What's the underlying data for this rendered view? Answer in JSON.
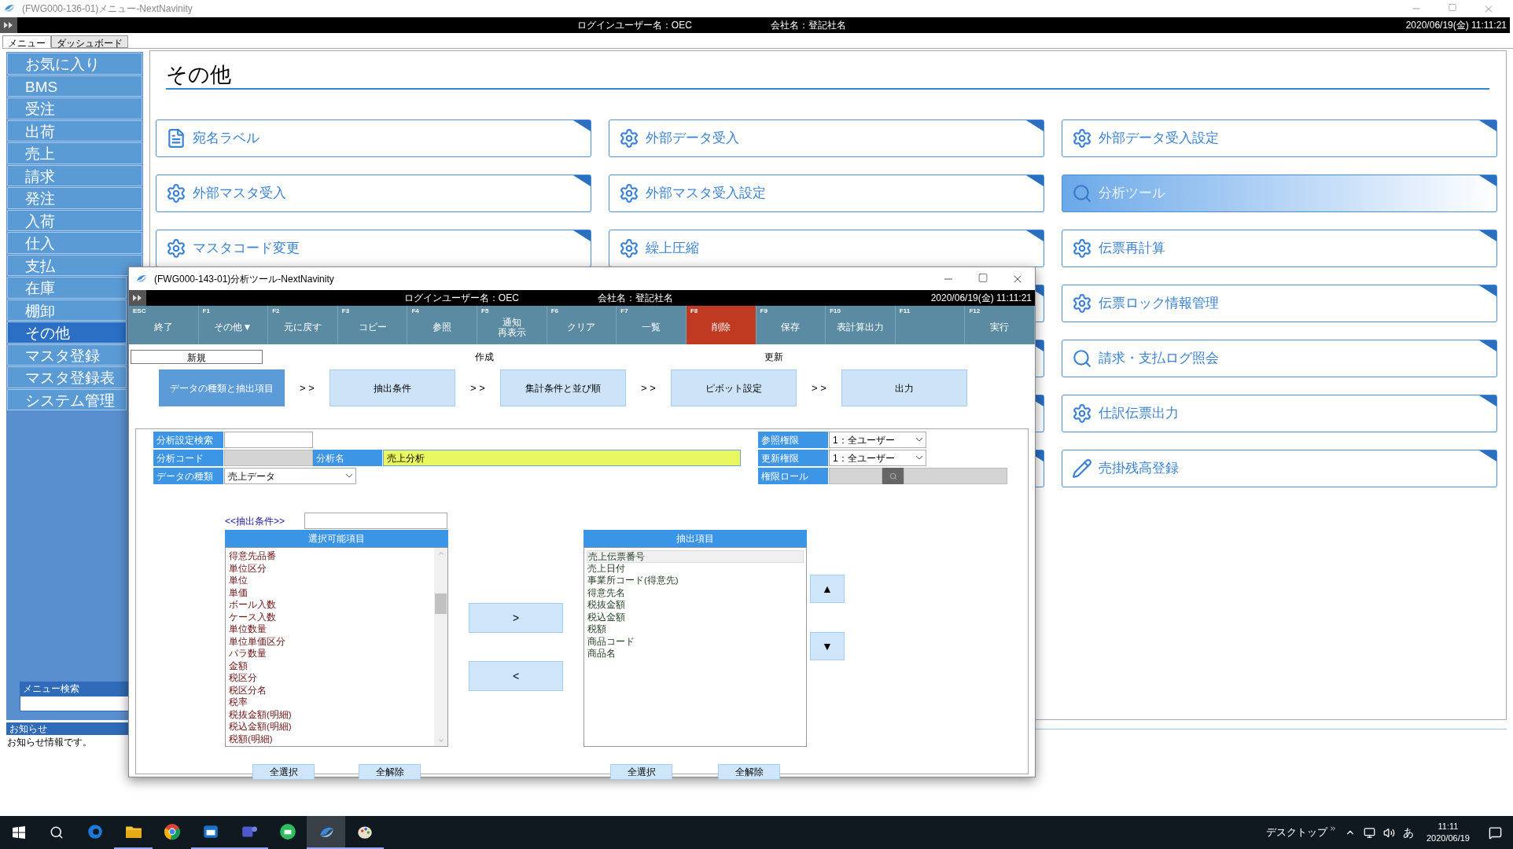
{
  "window": {
    "title": "(FWG000-136-01)メニュー-NextNavinity"
  },
  "header": {
    "login_user": "ログインユーザー名：OEC",
    "company": "会社名：登記社名",
    "datetime": "2020/06/19(金) 11:11:21"
  },
  "tabs": [
    {
      "label": "メニュー",
      "selected": true
    },
    {
      "label": "ダッシュボード",
      "selected": false
    }
  ],
  "sidebar": {
    "items": [
      {
        "label": "お気に入り",
        "selected": false
      },
      {
        "label": "BMS",
        "selected": false
      },
      {
        "label": "受注",
        "selected": false
      },
      {
        "label": "出荷",
        "selected": false
      },
      {
        "label": "売上",
        "selected": false
      },
      {
        "label": "請求",
        "selected": false
      },
      {
        "label": "発注",
        "selected": false
      },
      {
        "label": "入荷",
        "selected": false
      },
      {
        "label": "仕入",
        "selected": false
      },
      {
        "label": "支払",
        "selected": false
      },
      {
        "label": "在庫",
        "selected": false
      },
      {
        "label": "棚卸",
        "selected": false
      },
      {
        "label": "その他",
        "selected": true
      },
      {
        "label": "マスタ登録",
        "selected": false
      },
      {
        "label": "マスタ登録表",
        "selected": false
      },
      {
        "label": "システム管理",
        "selected": false
      }
    ],
    "search": {
      "label": "メニュー検索"
    }
  },
  "notice": {
    "title": "お知らせ",
    "text": "お知らせ情報です。"
  },
  "page": {
    "title": "その他",
    "columns": [
      [
        {
          "label": "宛名ラベル",
          "kind": "document",
          "selected": false
        },
        {
          "label": "外部マスタ受入",
          "kind": "setting",
          "selected": false
        },
        {
          "label": "マスタコード変更",
          "kind": "setting",
          "selected": false
        }
      ],
      [
        {
          "label": "外部データ受入",
          "kind": "setting",
          "selected": false
        },
        {
          "label": "外部マスタ受入設定",
          "kind": "setting",
          "selected": false
        },
        {
          "label": "繰上圧縮",
          "kind": "setting",
          "selected": false
        }
      ],
      [
        {
          "label": "外部データ受入設定",
          "kind": "setting",
          "selected": false
        },
        {
          "label": "分析ツール",
          "kind": "search",
          "selected": true
        },
        {
          "label": "伝票再計算",
          "kind": "setting",
          "selected": false
        },
        {
          "label": "伝票ロック情報管理",
          "kind": "setting",
          "selected": false
        },
        {
          "label": "請求・支払ログ照会",
          "kind": "search",
          "selected": false
        },
        {
          "label": "仕訳伝票出力",
          "kind": "setting",
          "selected": false
        },
        {
          "label": "売掛残高登録",
          "kind": "edit",
          "selected": false
        }
      ]
    ]
  },
  "dialog": {
    "title": "(FWG000-143-01)分析ツール-NextNavinity",
    "header": {
      "login_user": "ログインユーザー名：OEC",
      "company": "会社名：登記社名",
      "datetime": "2020/06/19(金) 11:11:21"
    },
    "function_keys": [
      {
        "key": "ESC",
        "label": "終了",
        "selected": false
      },
      {
        "key": "F1",
        "label": "その他▼",
        "selected": false
      },
      {
        "key": "F2",
        "label": "元に戻す",
        "selected": false
      },
      {
        "key": "F3",
        "label": "コピー",
        "selected": false
      },
      {
        "key": "F4",
        "label": "参照",
        "selected": false
      },
      {
        "key": "F5",
        "label": "通知",
        "label_line2": "再表示",
        "selected": false
      },
      {
        "key": "F6",
        "label": "クリア",
        "selected": false
      },
      {
        "key": "F7",
        "label": "一覧",
        "selected": false
      },
      {
        "key": "F8",
        "label": "削除",
        "selected": true
      },
      {
        "key": "F9",
        "label": "保存",
        "selected": false
      },
      {
        "key": "F10",
        "label": "表計算出力",
        "selected": false
      },
      {
        "key": "F11",
        "selected": false
      },
      {
        "key": "F12",
        "label": "実行",
        "selected": false
      }
    ],
    "modes": [
      {
        "label": "新規",
        "selected": true
      },
      {
        "label": "作成",
        "selected": false
      },
      {
        "label": "更新",
        "selected": false
      }
    ],
    "steps": [
      {
        "label": "データの種類と抽出項目",
        "selected": true
      },
      {
        "separator": "> >",
        "label": "抽出条件",
        "selected": false
      },
      {
        "separator": "> >",
        "label": "集計条件と並び順",
        "selected": false
      },
      {
        "separator": "> >",
        "label": "ピボット設定",
        "selected": false
      },
      {
        "separator": "> >",
        "label": "出力",
        "selected": false
      }
    ],
    "form": {
      "search_label": "分析設定検索",
      "code_label": "分析コード",
      "name_label": "分析名",
      "name_value": "売上分析",
      "type_label": "データの種類",
      "type_value": "売上データ",
      "view_label": "参照権限",
      "view_value": "1：全ユーザー",
      "update_label": "更新権限",
      "update_value": "1：全ユーザー",
      "role_label": "権限ロール"
    },
    "filter_label": "<<抽出条件>>",
    "available": {
      "title": "選択可能項目",
      "items": [
        "得意先品番",
        "単位区分",
        "単位",
        "単価",
        "ボール入数",
        "ケース入数",
        "単位数量",
        "単位単価区分",
        "バラ数量",
        "金額",
        "税区分",
        "税区分名",
        "税率",
        "税抜金額(明細)",
        "税込金額(明細)",
        "税額(明細)"
      ]
    },
    "chosen": {
      "title": "抽出項目",
      "items": [
        {
          "label": "売上伝票番号",
          "selected": true
        },
        {
          "label": "売上日付",
          "selected": false
        },
        {
          "label": "事業所コード(得意先)",
          "selected": false
        },
        {
          "label": "得意先名",
          "selected": false
        },
        {
          "label": "税抜金額",
          "selected": false
        },
        {
          "label": "税込金額",
          "selected": false
        },
        {
          "label": "税額",
          "selected": false
        },
        {
          "label": "商品コード",
          "selected": false
        },
        {
          "label": "商品名",
          "selected": false
        }
      ]
    },
    "add_button": ">",
    "remove_button": "<",
    "up_button": "▲",
    "down_button": "▼",
    "left_buttons": [
      "全選択",
      "全解除"
    ],
    "right_buttons": [
      "全選択",
      "全解除"
    ]
  },
  "taskbar": {
    "apps": [
      {
        "running": false,
        "selected": false
      },
      {
        "running": true,
        "selected": false
      },
      {
        "running": false,
        "selected": false
      },
      {
        "running": true,
        "selected": false
      },
      {
        "running": true,
        "selected": false
      },
      {
        "running": false,
        "selected": false
      },
      {
        "running": true,
        "selected": true
      },
      {
        "running": true,
        "selected": false
      }
    ],
    "desktop": "デスクトップ",
    "ime": "あ",
    "time": "11:11",
    "date": "2020/06/19"
  }
}
